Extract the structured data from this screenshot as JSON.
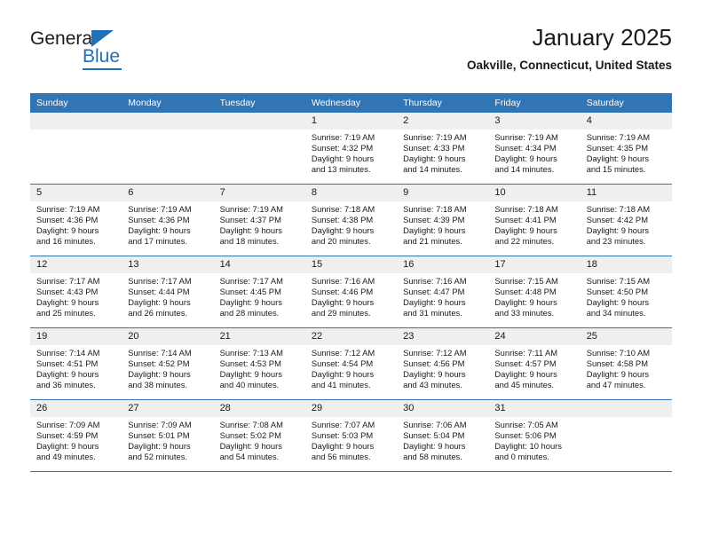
{
  "brand": {
    "name_top": "General",
    "name_bottom": "Blue",
    "accent_color": "#1e70b8"
  },
  "header": {
    "title": "January 2025",
    "subtitle": "Oakville, Connecticut, United States"
  },
  "theme": {
    "header_blue": "#3275b4",
    "daynum_band": "#efefef",
    "text": "#1a1a1a"
  },
  "weekday_headers": [
    "Sunday",
    "Monday",
    "Tuesday",
    "Wednesday",
    "Thursday",
    "Friday",
    "Saturday"
  ],
  "labels": {
    "sunrise": "Sunrise:",
    "sunset": "Sunset:",
    "daylight": "Daylight:"
  },
  "weeks": [
    [
      {
        "day": "",
        "empty": true
      },
      {
        "day": "",
        "empty": true
      },
      {
        "day": "",
        "empty": true
      },
      {
        "day": "1",
        "sunrise": "Sunrise: 7:19 AM",
        "sunset": "Sunset: 4:32 PM",
        "daylight1": "Daylight: 9 hours",
        "daylight2": "and 13 minutes."
      },
      {
        "day": "2",
        "sunrise": "Sunrise: 7:19 AM",
        "sunset": "Sunset: 4:33 PM",
        "daylight1": "Daylight: 9 hours",
        "daylight2": "and 14 minutes."
      },
      {
        "day": "3",
        "sunrise": "Sunrise: 7:19 AM",
        "sunset": "Sunset: 4:34 PM",
        "daylight1": "Daylight: 9 hours",
        "daylight2": "and 14 minutes."
      },
      {
        "day": "4",
        "sunrise": "Sunrise: 7:19 AM",
        "sunset": "Sunset: 4:35 PM",
        "daylight1": "Daylight: 9 hours",
        "daylight2": "and 15 minutes."
      }
    ],
    [
      {
        "day": "5",
        "sunrise": "Sunrise: 7:19 AM",
        "sunset": "Sunset: 4:36 PM",
        "daylight1": "Daylight: 9 hours",
        "daylight2": "and 16 minutes."
      },
      {
        "day": "6",
        "sunrise": "Sunrise: 7:19 AM",
        "sunset": "Sunset: 4:36 PM",
        "daylight1": "Daylight: 9 hours",
        "daylight2": "and 17 minutes."
      },
      {
        "day": "7",
        "sunrise": "Sunrise: 7:19 AM",
        "sunset": "Sunset: 4:37 PM",
        "daylight1": "Daylight: 9 hours",
        "daylight2": "and 18 minutes."
      },
      {
        "day": "8",
        "sunrise": "Sunrise: 7:18 AM",
        "sunset": "Sunset: 4:38 PM",
        "daylight1": "Daylight: 9 hours",
        "daylight2": "and 20 minutes."
      },
      {
        "day": "9",
        "sunrise": "Sunrise: 7:18 AM",
        "sunset": "Sunset: 4:39 PM",
        "daylight1": "Daylight: 9 hours",
        "daylight2": "and 21 minutes."
      },
      {
        "day": "10",
        "sunrise": "Sunrise: 7:18 AM",
        "sunset": "Sunset: 4:41 PM",
        "daylight1": "Daylight: 9 hours",
        "daylight2": "and 22 minutes."
      },
      {
        "day": "11",
        "sunrise": "Sunrise: 7:18 AM",
        "sunset": "Sunset: 4:42 PM",
        "daylight1": "Daylight: 9 hours",
        "daylight2": "and 23 minutes."
      }
    ],
    [
      {
        "day": "12",
        "sunrise": "Sunrise: 7:17 AM",
        "sunset": "Sunset: 4:43 PM",
        "daylight1": "Daylight: 9 hours",
        "daylight2": "and 25 minutes."
      },
      {
        "day": "13",
        "sunrise": "Sunrise: 7:17 AM",
        "sunset": "Sunset: 4:44 PM",
        "daylight1": "Daylight: 9 hours",
        "daylight2": "and 26 minutes."
      },
      {
        "day": "14",
        "sunrise": "Sunrise: 7:17 AM",
        "sunset": "Sunset: 4:45 PM",
        "daylight1": "Daylight: 9 hours",
        "daylight2": "and 28 minutes."
      },
      {
        "day": "15",
        "sunrise": "Sunrise: 7:16 AM",
        "sunset": "Sunset: 4:46 PM",
        "daylight1": "Daylight: 9 hours",
        "daylight2": "and 29 minutes."
      },
      {
        "day": "16",
        "sunrise": "Sunrise: 7:16 AM",
        "sunset": "Sunset: 4:47 PM",
        "daylight1": "Daylight: 9 hours",
        "daylight2": "and 31 minutes."
      },
      {
        "day": "17",
        "sunrise": "Sunrise: 7:15 AM",
        "sunset": "Sunset: 4:48 PM",
        "daylight1": "Daylight: 9 hours",
        "daylight2": "and 33 minutes."
      },
      {
        "day": "18",
        "sunrise": "Sunrise: 7:15 AM",
        "sunset": "Sunset: 4:50 PM",
        "daylight1": "Daylight: 9 hours",
        "daylight2": "and 34 minutes."
      }
    ],
    [
      {
        "day": "19",
        "sunrise": "Sunrise: 7:14 AM",
        "sunset": "Sunset: 4:51 PM",
        "daylight1": "Daylight: 9 hours",
        "daylight2": "and 36 minutes."
      },
      {
        "day": "20",
        "sunrise": "Sunrise: 7:14 AM",
        "sunset": "Sunset: 4:52 PM",
        "daylight1": "Daylight: 9 hours",
        "daylight2": "and 38 minutes."
      },
      {
        "day": "21",
        "sunrise": "Sunrise: 7:13 AM",
        "sunset": "Sunset: 4:53 PM",
        "daylight1": "Daylight: 9 hours",
        "daylight2": "and 40 minutes."
      },
      {
        "day": "22",
        "sunrise": "Sunrise: 7:12 AM",
        "sunset": "Sunset: 4:54 PM",
        "daylight1": "Daylight: 9 hours",
        "daylight2": "and 41 minutes."
      },
      {
        "day": "23",
        "sunrise": "Sunrise: 7:12 AM",
        "sunset": "Sunset: 4:56 PM",
        "daylight1": "Daylight: 9 hours",
        "daylight2": "and 43 minutes."
      },
      {
        "day": "24",
        "sunrise": "Sunrise: 7:11 AM",
        "sunset": "Sunset: 4:57 PM",
        "daylight1": "Daylight: 9 hours",
        "daylight2": "and 45 minutes."
      },
      {
        "day": "25",
        "sunrise": "Sunrise: 7:10 AM",
        "sunset": "Sunset: 4:58 PM",
        "daylight1": "Daylight: 9 hours",
        "daylight2": "and 47 minutes."
      }
    ],
    [
      {
        "day": "26",
        "sunrise": "Sunrise: 7:09 AM",
        "sunset": "Sunset: 4:59 PM",
        "daylight1": "Daylight: 9 hours",
        "daylight2": "and 49 minutes."
      },
      {
        "day": "27",
        "sunrise": "Sunrise: 7:09 AM",
        "sunset": "Sunset: 5:01 PM",
        "daylight1": "Daylight: 9 hours",
        "daylight2": "and 52 minutes."
      },
      {
        "day": "28",
        "sunrise": "Sunrise: 7:08 AM",
        "sunset": "Sunset: 5:02 PM",
        "daylight1": "Daylight: 9 hours",
        "daylight2": "and 54 minutes."
      },
      {
        "day": "29",
        "sunrise": "Sunrise: 7:07 AM",
        "sunset": "Sunset: 5:03 PM",
        "daylight1": "Daylight: 9 hours",
        "daylight2": "and 56 minutes."
      },
      {
        "day": "30",
        "sunrise": "Sunrise: 7:06 AM",
        "sunset": "Sunset: 5:04 PM",
        "daylight1": "Daylight: 9 hours",
        "daylight2": "and 58 minutes."
      },
      {
        "day": "31",
        "sunrise": "Sunrise: 7:05 AM",
        "sunset": "Sunset: 5:06 PM",
        "daylight1": "Daylight: 10 hours",
        "daylight2": "and 0 minutes."
      },
      {
        "day": "",
        "empty": true
      }
    ]
  ]
}
